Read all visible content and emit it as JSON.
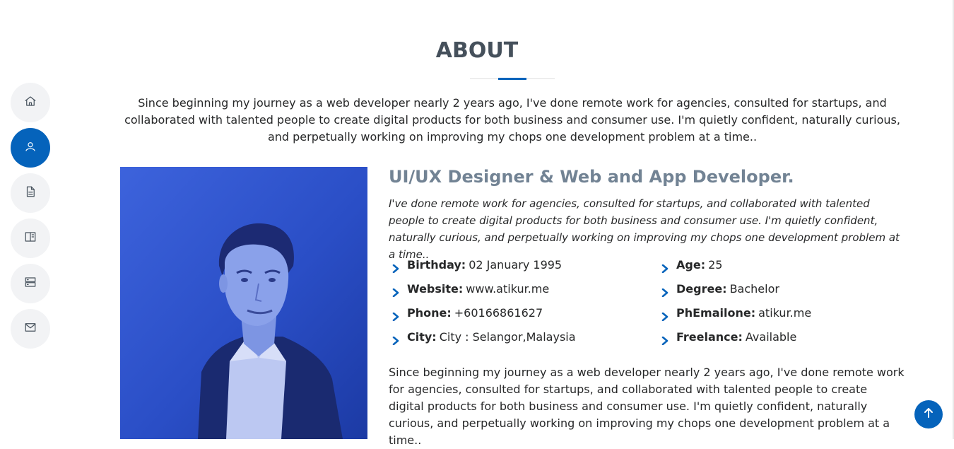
{
  "section": {
    "title": "ABOUT",
    "intro": "Since beginning my journey as a web developer nearly 2 years ago, I've done remote work for agencies, consulted for startups, and collaborated with talented people to create digital products for both business and consumer use. I'm quietly confident, naturally curious, and perpetually working on improving my chops one development problem at a time.."
  },
  "nav": {
    "items": [
      {
        "icon": "home-icon",
        "active": false
      },
      {
        "icon": "user-icon",
        "active": true
      },
      {
        "icon": "file-icon",
        "active": false
      },
      {
        "icon": "book-icon",
        "active": false
      },
      {
        "icon": "server-icon",
        "active": false
      },
      {
        "icon": "envelope-icon",
        "active": false
      }
    ]
  },
  "about": {
    "role": "UI/UX Designer & Web and App Developer.",
    "role_desc": "I've done remote work for agencies, consulted for startups, and collaborated with talented people to create digital products for both business and consumer use. I'm quietly confident, naturally curious, and perpetually working on improving my chops one development problem at a time..",
    "left_info": [
      {
        "label": "Birthday:",
        "value": "02 January 1995"
      },
      {
        "label": "Website:",
        "value": "www.atikur.me"
      },
      {
        "label": "Phone:",
        "value": "+60166861627"
      },
      {
        "label": "City:",
        "value": "City : Selangor,Malaysia"
      }
    ],
    "right_info": [
      {
        "label": "Age:",
        "value": "25"
      },
      {
        "label": "Degree:",
        "value": "Bachelor"
      },
      {
        "label": "PhEmailone:",
        "value": "atikur.me"
      },
      {
        "label": "Freelance:",
        "value": "Available"
      }
    ],
    "bottom_para": "Since beginning my journey as a web developer nearly 2 years ago, I've done remote work for agencies, consulted for startups, and collaborated with talented people to create digital products for both business and consumer use. I'm quietly confident, naturally curious, and perpetually working on improving my chops one development problem at a time.."
  },
  "colors": {
    "accent": "#0563bb",
    "title": "#45505b",
    "role": "#728394",
    "nav_bg": "#f2f3f5"
  },
  "back_to_top": {
    "icon": "arrow-up-icon"
  }
}
